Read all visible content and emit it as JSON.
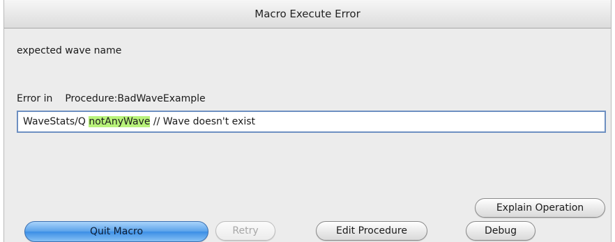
{
  "window": {
    "title": "Macro Execute Error"
  },
  "error": {
    "message": "expected wave name",
    "location_label": "Error in",
    "location_value": "Procedure:BadWaveExample"
  },
  "code_line": {
    "before": "WaveStats/Q ",
    "highlight": "notAnyWave",
    "after": " // Wave doesn't exist",
    "highlight_color": "#b8f27a"
  },
  "buttons": {
    "explain": "Explain Operation",
    "quit": "Quit Macro",
    "retry": "Retry",
    "edit": "Edit Procedure",
    "debug": "Debug"
  },
  "colors": {
    "default_button": "#5aa2ea",
    "field_focus": "#6d8fc1"
  }
}
